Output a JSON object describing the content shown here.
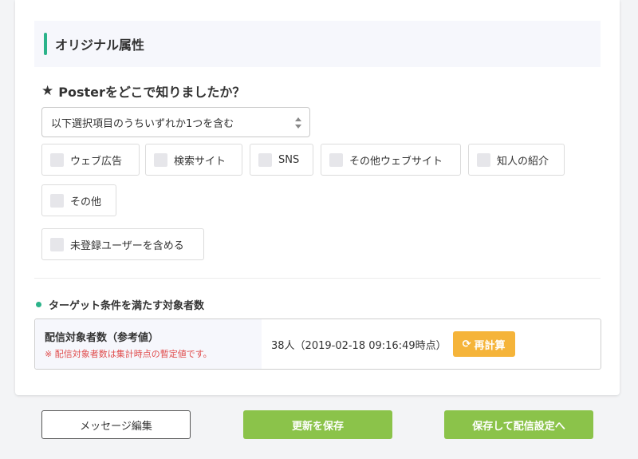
{
  "section": {
    "title": "オリジナル属性"
  },
  "question": {
    "icon": "star-icon",
    "text": "Posterをどこで知りましたか？"
  },
  "select": {
    "value": "以下選択項目のうちいずれか1つを含む"
  },
  "options": [
    {
      "label": "ウェブ広告",
      "checked": false
    },
    {
      "label": "検索サイト",
      "checked": false
    },
    {
      "label": "SNS",
      "checked": false
    },
    {
      "label": "その他ウェブサイト",
      "checked": false
    },
    {
      "label": "知人の紹介",
      "checked": false
    },
    {
      "label": "その他",
      "checked": false
    }
  ],
  "include_unregistered": {
    "label": "未登録ユーザーを含める",
    "checked": false
  },
  "target": {
    "heading": "ターゲット条件を満たす対象者数",
    "count_label": "配信対象者数（参考値）",
    "count_note": "※ 配信対象者数は集計時点の暫定値です。",
    "count_value": "38人（2019-02-18 09:16:49時点）",
    "recalc_label": "再計算"
  },
  "footer": {
    "edit_message_label": "メッセージ編集",
    "save_label": "更新を保存",
    "save_and_config_label": "保存して配信設定へ"
  },
  "colors": {
    "accent_green": "#2bb38a",
    "button_green": "#8bc34a",
    "recalc_orange": "#f5b43a",
    "note_red": "#e04c4c"
  }
}
